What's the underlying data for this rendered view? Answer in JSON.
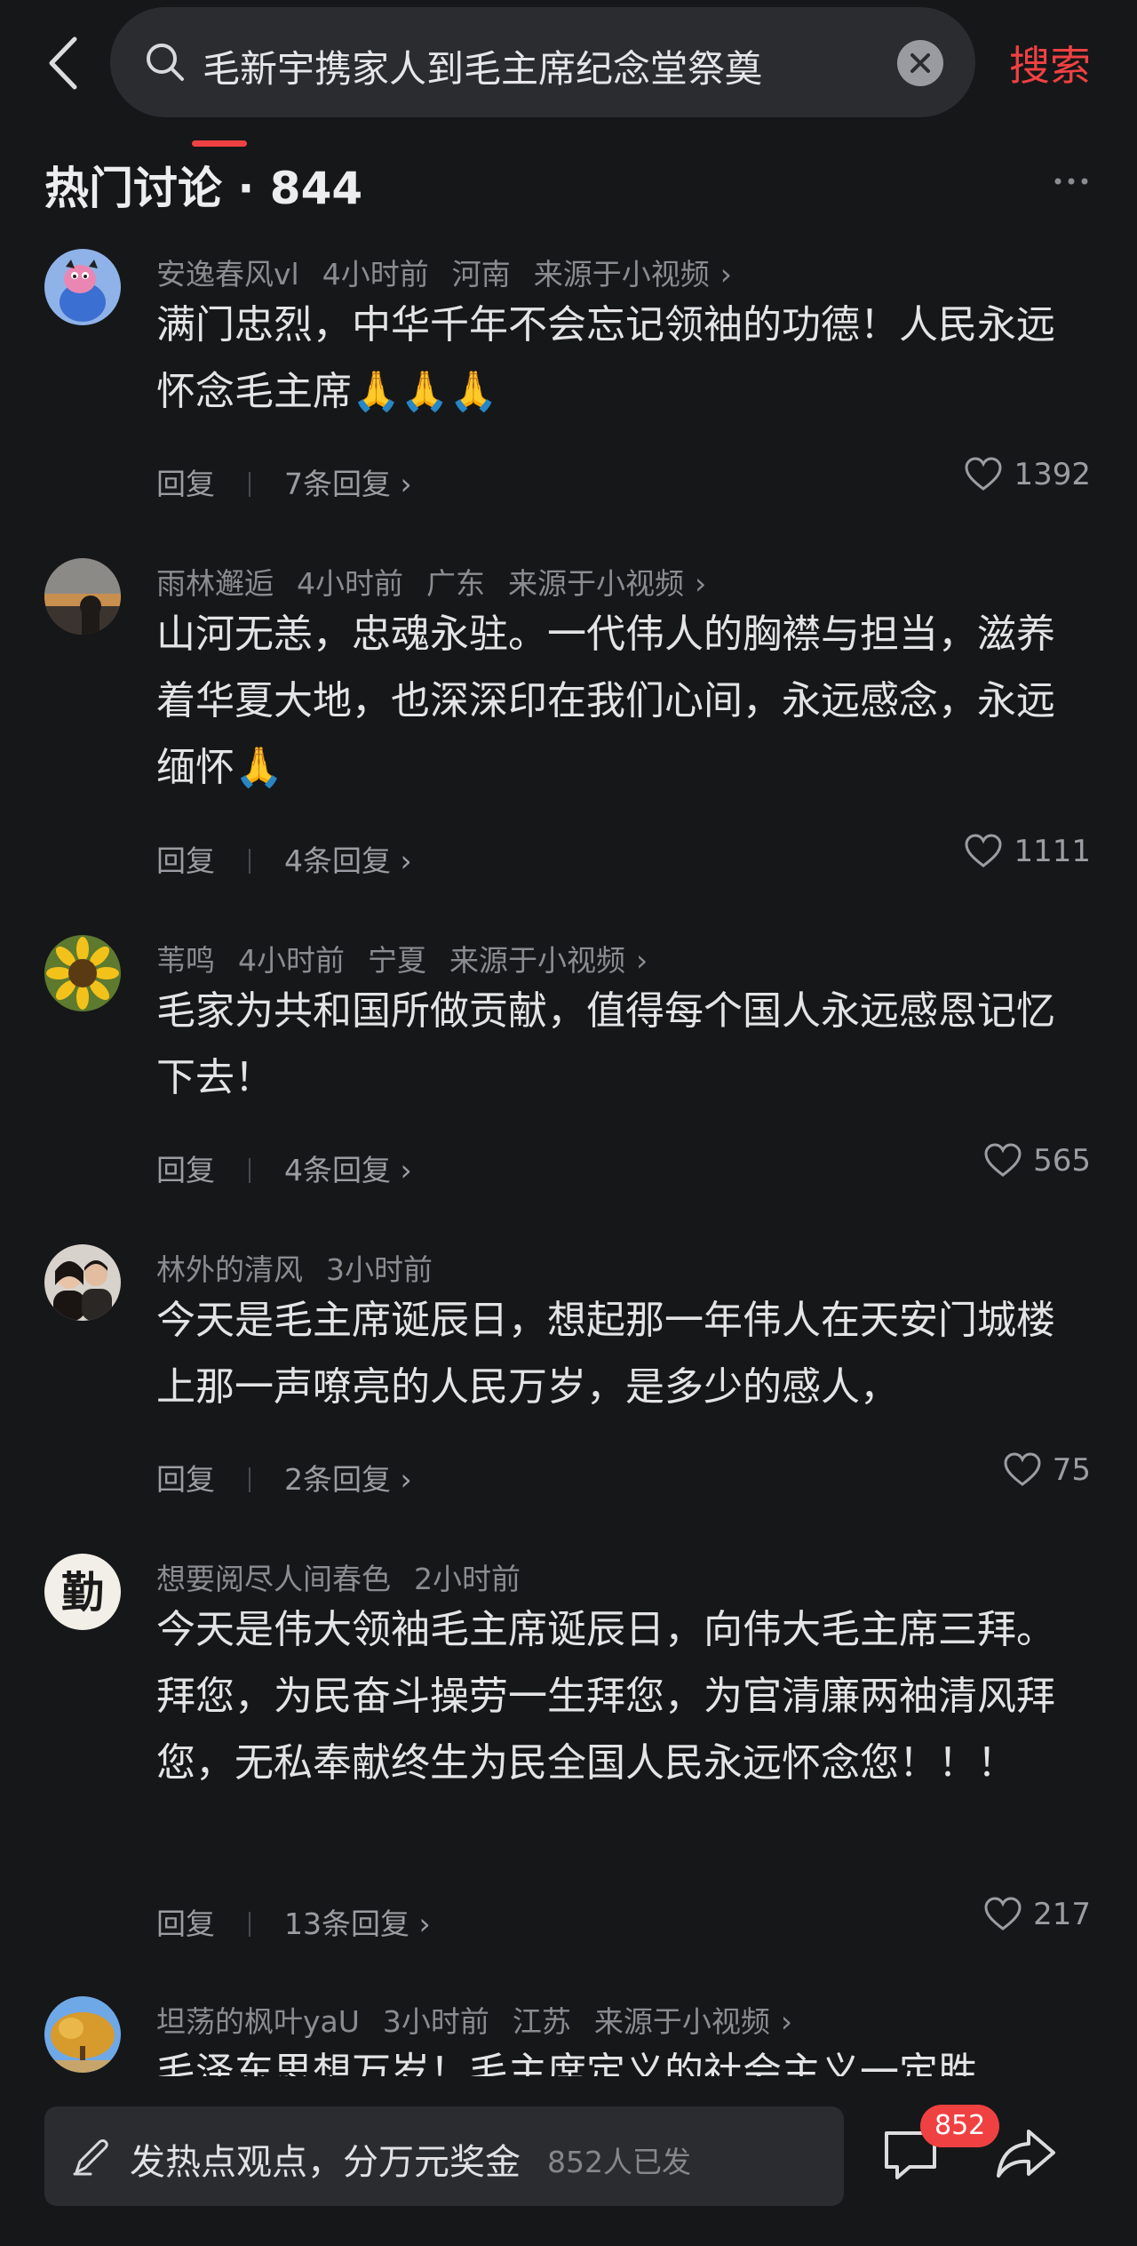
{
  "header": {
    "search_query": "毛新宇携家人到毛主席纪念堂祭奠",
    "search_button": "搜索"
  },
  "section": {
    "title": "热门讨论 · 844"
  },
  "comments": [
    {
      "username": "安逸春风vl",
      "time": "4小时前",
      "location": "河南",
      "source": "来源于小视频",
      "text": "满门忠烈，中华千年不会忘记领袖的功德！人民永远怀念毛主席🙏🙏🙏",
      "reply_label": "回复",
      "replies": "7条回复",
      "likes": "1392"
    },
    {
      "username": "雨林邂逅",
      "time": "4小时前",
      "location": "广东",
      "source": "来源于小视频",
      "text": "山河无恙，忠魂永驻。一代伟人的胸襟与担当，滋养着华夏大地，也深深印在我们心间，永远感念，永远缅怀🙏",
      "reply_label": "回复",
      "replies": "4条回复",
      "likes": "1111"
    },
    {
      "username": "苇鸣",
      "time": "4小时前",
      "location": "宁夏",
      "source": "来源于小视频",
      "text": "毛家为共和国所做贡献，值得每个国人永远感恩记忆下去！",
      "reply_label": "回复",
      "replies": "4条回复",
      "likes": "565"
    },
    {
      "username": "林外的清风",
      "time": "3小时前",
      "location": "",
      "source": "",
      "text": "今天是毛主席诞辰日，想起那一年伟人在天安门城楼上那一声嘹亮的人民万岁，是多少的感人，",
      "reply_label": "回复",
      "replies": "2条回复",
      "likes": "75"
    },
    {
      "username": "想要阅尽人间春色",
      "time": "2小时前",
      "location": "",
      "source": "",
      "text": "今天是伟大领袖毛主席诞辰日，向伟大毛主席三拜。拜您，为民奋斗操劳一生拜您，为官清廉两袖清风拜您，无私奉献终生为民全国人民永远怀念您！！！",
      "reply_label": "回复",
      "replies": "13条回复",
      "likes": "217"
    },
    {
      "username": "坦荡的枫叶yaU",
      "time": "3小时前",
      "location": "江苏",
      "source": "来源于小视频",
      "text": "毛泽东思想万岁！毛主席定义的社会主义一定胜",
      "reply_label": "",
      "replies": "",
      "likes": ""
    }
  ],
  "bottom_bar": {
    "compose_label": "发热点观点，分万元奖金",
    "compose_count": "852人已发",
    "comment_badge": "852"
  },
  "colors": {
    "background": "#161719",
    "accent": "#f04142",
    "surface": "#2b2c30",
    "muted_text": "#8b8c91"
  },
  "icons": [
    "back-icon",
    "search-icon",
    "clear-icon",
    "more-icon",
    "heart-icon",
    "chevron-right-icon",
    "pen-icon",
    "comment-bubble-icon",
    "share-icon"
  ]
}
